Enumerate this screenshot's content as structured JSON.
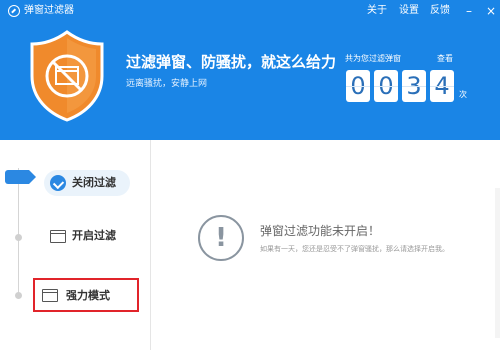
{
  "window": {
    "title": "弹窗过滤器",
    "menu": {
      "about": "关于",
      "settings": "设置",
      "feedback": "反馈"
    },
    "minimize_glyph": "–",
    "close_glyph": "×"
  },
  "hero": {
    "headline": "过滤弹窗、防骚扰，就这么给力",
    "subline": "远离骚扰，安静上网",
    "shield_color": "#f08a2c",
    "background_color": "#1a85e6"
  },
  "counter": {
    "label": "共为您过滤弹窗",
    "view_link": "查看",
    "digits": [
      "0",
      "0",
      "3",
      "4"
    ],
    "unit": "次"
  },
  "sidebar": {
    "items": [
      {
        "label": "关闭过滤",
        "icon": "check-circle-icon",
        "state": "active"
      },
      {
        "label": "开启过滤",
        "icon": "window-icon",
        "state": "inactive"
      },
      {
        "label": "强力模式",
        "icon": "window-icon",
        "state": "highlighted"
      }
    ],
    "accent_color": "#2b88e2",
    "highlight_color": "#e1242a"
  },
  "status": {
    "icon": "exclamation-circle-icon",
    "glyph": "!",
    "title": "弹窗过滤功能未开启！",
    "description": "如果有一天，您还是忍受不了弹窗骚扰，那么请选择开启我。"
  }
}
